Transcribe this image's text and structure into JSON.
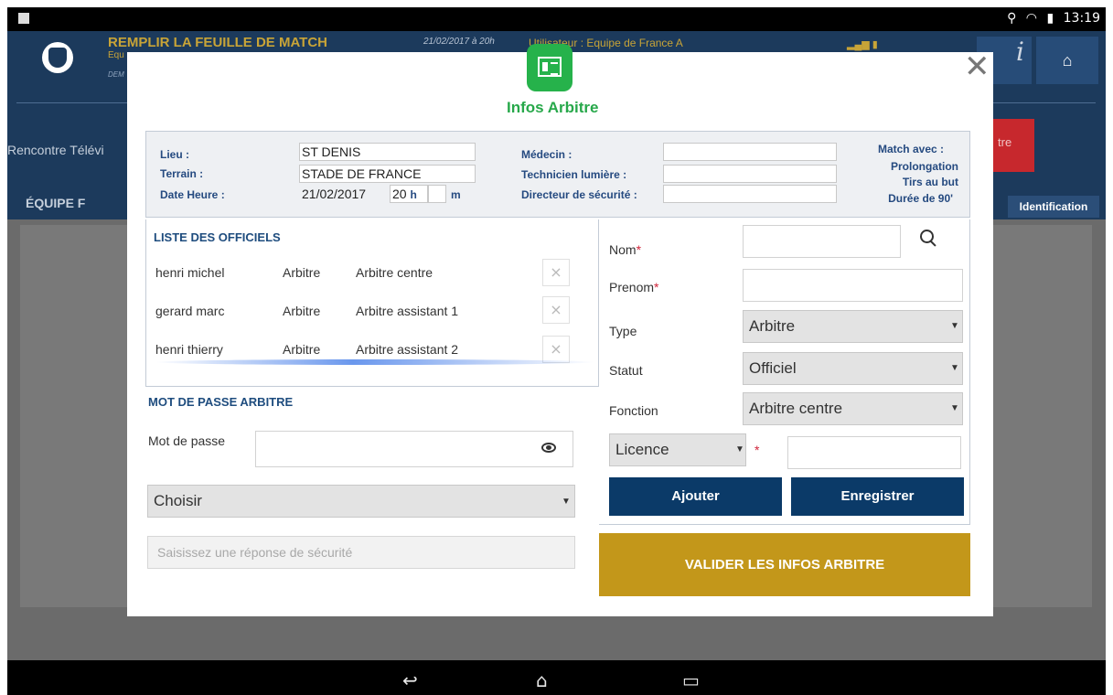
{
  "status_bar": {
    "time": "13:19"
  },
  "app_header": {
    "title": "REMPLIR LA FEUILLE DE MATCH",
    "subtitle_1": "Equ",
    "subtitle_2": "DEM",
    "date": "21/02/2017 à 20h",
    "user_label": "Utilisateur",
    "user_value": "Equipe de France A",
    "info_icon": "i"
  },
  "app_sub": {
    "rencontre": "Rencontre Télévi",
    "red_button": "tre",
    "equipe": "ÉQUIPE F",
    "identification": "Identification"
  },
  "modal": {
    "title": "Infos Arbitre",
    "info": {
      "lieu_label": "Lieu :",
      "lieu_value": "ST DENIS",
      "terrain_label": "Terrain :",
      "terrain_value": "STADE DE FRANCE",
      "date_label": "Date Heure :",
      "date_value": "21/02/2017",
      "hour_value": "20",
      "hour_unit": "h",
      "minute_unit": "m",
      "medecin_label": "Médecin :",
      "technicien_label": "Technicien lumière :",
      "directeur_label": "Directeur de sécurité :",
      "match_avec_label": "Match avec :",
      "match_options": [
        "Prolongation",
        "Tirs au but",
        "Durée de 90'"
      ]
    },
    "officials": {
      "heading": "LISTE DES OFFICIELS",
      "rows": [
        {
          "name": "henri michel",
          "type": "Arbitre",
          "fonction": "Arbitre centre"
        },
        {
          "name": "gerard marc",
          "type": "Arbitre",
          "fonction": "Arbitre assistant 1"
        },
        {
          "name": "henri thierry",
          "type": "Arbitre",
          "fonction": "Arbitre assistant 2"
        }
      ],
      "remove_glyph": "×"
    },
    "password": {
      "heading": "MOT DE PASSE ARBITRE",
      "label": "Mot de passe",
      "select_value": "Choisir",
      "security_placeholder": "Saisissez une réponse de sécurité"
    },
    "form": {
      "nom_label": "Nom",
      "prenom_label": "Prenom",
      "required_mark": "*",
      "type_label": "Type",
      "type_value": "Arbitre",
      "statut_label": "Statut",
      "statut_value": "Officiel",
      "fonction_label": "Fonction",
      "fonction_value": "Arbitre centre",
      "licence_value": "Licence",
      "ajouter": "Ajouter",
      "enregistrer": "Enregistrer"
    },
    "validate_button": "VALIDER LES INFOS ARBITRE"
  },
  "colors": {
    "header_blue": "#1c3a5c",
    "gold": "#c3971a",
    "green": "#26b24b",
    "dark_button": "#0b3a68",
    "label_blue": "#254a80"
  }
}
